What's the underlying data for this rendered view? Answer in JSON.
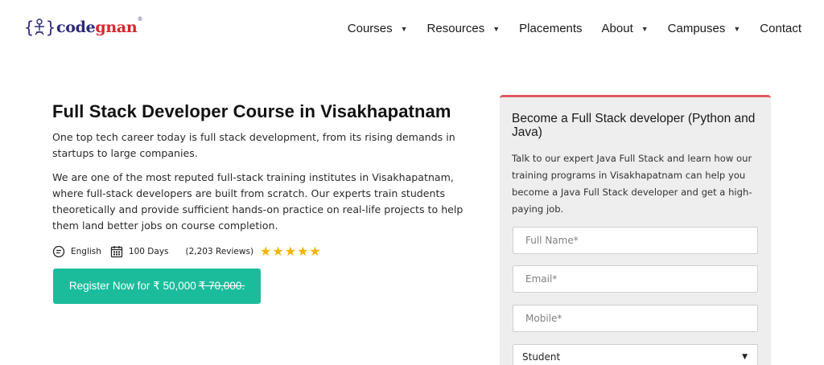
{
  "brand": {
    "name_prefix": "code",
    "name_accent": "gnan",
    "registered": "®"
  },
  "nav": [
    {
      "label": "Courses",
      "has_dropdown": true
    },
    {
      "label": "Resources",
      "has_dropdown": true
    },
    {
      "label": "Placements",
      "has_dropdown": false
    },
    {
      "label": "About",
      "has_dropdown": true
    },
    {
      "label": "Campuses",
      "has_dropdown": true
    },
    {
      "label": "Contact",
      "has_dropdown": false
    }
  ],
  "hero": {
    "title": "Full Stack Developer Course in Visakhapatnam",
    "para1": "One top tech career today is full stack development, from its rising demands in startups to large companies.",
    "para2": "We are one of the most reputed full-stack training institutes in Visakhapatnam, where full-stack developers are built from scratch. Our experts train students theoretically and provide sufficient hands-on practice on real-life projects to help them land better jobs on course completion.",
    "language": "English",
    "duration": "100 Days",
    "reviews": "(2,203 Reviews)",
    "rating_stars": 5,
    "register_label": "Register Now for ₹ 50,000",
    "old_price": "₹ 70,000."
  },
  "form": {
    "title": "Become a Full Stack developer (Python and Java)",
    "description": "Talk to our expert Java Full Stack and learn how our training programs in Visakhapatnam can help you become a Java Full Stack developer and get a high-paying job.",
    "name_placeholder": "Full Name*",
    "email_placeholder": "Email*",
    "mobile_placeholder": "Mobile*",
    "status_selected": "Student"
  },
  "colors": {
    "accent_green": "#1abc9c",
    "brand_navy": "#2c2a7a",
    "brand_red": "#d8262f",
    "star": "#f5b301",
    "card_border": "#e05a62"
  }
}
